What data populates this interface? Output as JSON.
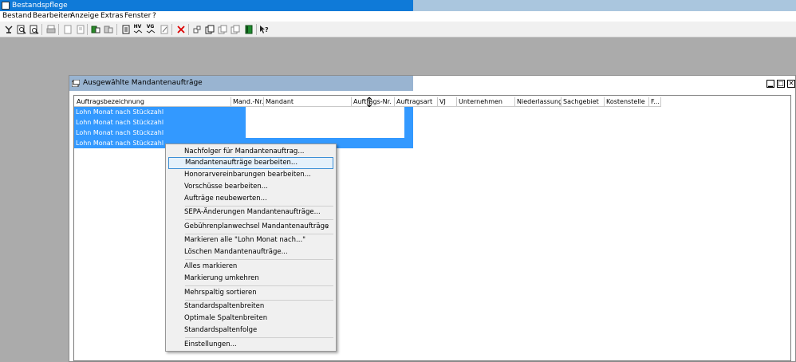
{
  "app": {
    "title": "Bestandspflege"
  },
  "menu": [
    "Bestand",
    "Bearbeiten",
    "Anzeige",
    "Extras",
    "Fenster",
    "?"
  ],
  "toolbar": {
    "icons": [
      "tree-icon",
      "zoom-icon",
      "zoom-doc-icon",
      "print-icon",
      "new-doc-icon",
      "doc-icon",
      "export-icon",
      "import-icon",
      "page-icon",
      "hv-icon",
      "vg-icon",
      "edit-icon",
      "delete-icon",
      "window-icon",
      "copy-icon",
      "copy2-icon",
      "copy3-icon",
      "book-icon",
      "help-icon"
    ],
    "hv": "HV",
    "vg": "VG"
  },
  "window": {
    "title": "Ausgewählte Mandantenaufträge"
  },
  "table": {
    "columns": [
      "Auftragsbezeichnung",
      "Mand.-Nr.",
      "Mandant",
      "Auftrags-Nr.",
      "Auftragsart",
      "VJ",
      "Unternehmen",
      "Niederlassung",
      "Sachgebiet",
      "Kostenstelle",
      "F..."
    ],
    "rows": [
      {
        "bezeichnung": "Lohn Monat nach Stückzahl",
        "tail": "0"
      },
      {
        "bezeichnung": "Lohn Monat nach Stückzahl",
        "tail": "0"
      },
      {
        "bezeichnung": "Lohn Monat nach Stückzahl",
        "tail": "0"
      },
      {
        "bezeichnung": "Lohn Monat nach Stückzahl",
        "tail": "0"
      }
    ]
  },
  "context_menu": {
    "items": [
      "Nachfolger für Mandantenauftrag...",
      "Mandantenaufträge bearbeiten...",
      "Honorarvereinbarungen bearbeiten...",
      "Vorschüsse bearbeiten...",
      "Aufträge neubewerten...",
      "SEPA-Änderungen Mandantenaufträge...",
      "Gebührenplanwechsel Mandantenaufträge",
      "Markieren alle \"Lohn Monat nach...\"",
      "Löschen Mandantenaufträge...",
      "Alles markieren",
      "Markierung umkehren",
      "Mehrspaltig sortieren",
      "Standardspaltenbreiten",
      "Optimale Spaltenbreiten",
      "Standardspaltenfolge",
      "Einstellungen..."
    ],
    "highlighted": "Mandantenaufträge bearbeiten...",
    "submenu_arrow": "›"
  }
}
